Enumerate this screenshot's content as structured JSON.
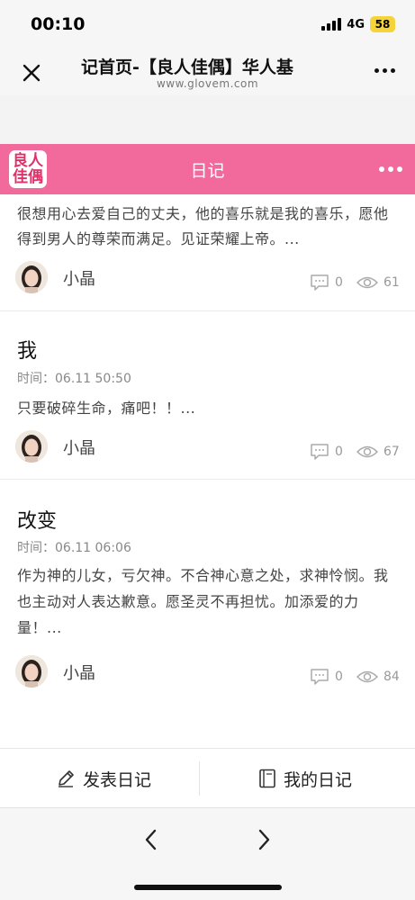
{
  "status_bar": {
    "time": "00:10",
    "network": "4G",
    "battery": "58"
  },
  "browser": {
    "title": "记首页-【良人佳偶】华人基",
    "url": "www.glovem.com"
  },
  "header": {
    "logo_line1": "良人",
    "logo_line2": "佳偶",
    "title": "日记"
  },
  "entries": [
    {
      "title": "",
      "time": "",
      "text": "很想用心去爱自己的丈夫，他的喜乐就是我的喜乐，愿他得到男人的尊荣而满足。见证荣耀上帝。...",
      "author": "小晶",
      "comments": "0",
      "views": "61"
    },
    {
      "title": "我",
      "time": "时间：06.11 50:50",
      "text": "只要破碎生命，痛吧！！...",
      "author": "小晶",
      "comments": "0",
      "views": "67"
    },
    {
      "title": "改变",
      "time": "时间：06.11 06:06",
      "text": "作为神的儿女，亏欠神。不合神心意之处，求神怜悯。我也主动对人表达歉意。愿圣灵不再担忧。加添爱的力量！...",
      "author": "小晶",
      "comments": "0",
      "views": "84"
    }
  ],
  "actions": {
    "publish": "发表日记",
    "my_diary": "我的日记"
  },
  "colors": {
    "accent": "#f2699c"
  }
}
